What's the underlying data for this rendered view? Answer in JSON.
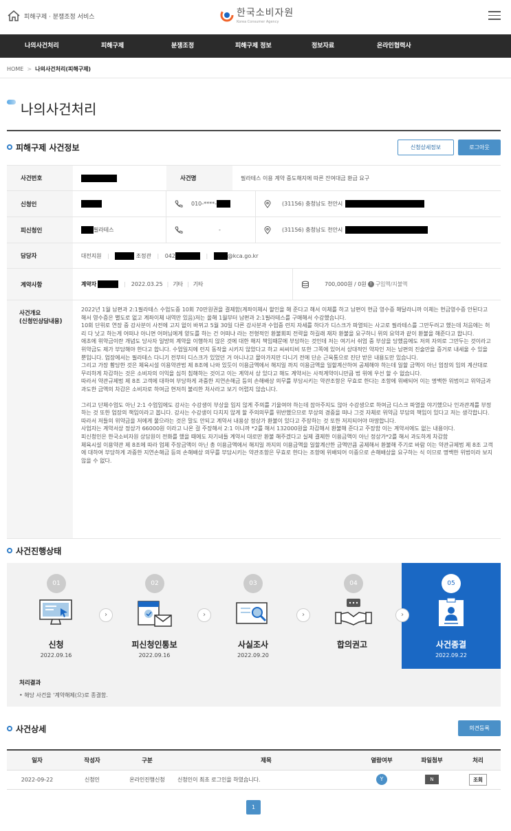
{
  "header": {
    "service_name": "피해구제 · 분쟁조정 서비스",
    "logo_ko": "한국소비자원",
    "logo_en": "Korea Consumer Agency"
  },
  "gnb": [
    "나의사건처리",
    "피해구제",
    "분쟁조정",
    "피해구제 정보",
    "정보자료",
    "온라인협력사"
  ],
  "breadcrumb": {
    "home": "HOME",
    "sep": ">",
    "current": "나의사건처리(피해구제)"
  },
  "page_title": "나의사건처리",
  "section1": {
    "title": "피해구제 사건정보",
    "detail_btn": "신청상세정보",
    "logout_btn": "로그아웃"
  },
  "info": {
    "case_no_label": "사건번호",
    "case_name_label": "사건명",
    "case_name": "필라테스 이용 계약 중도해지에 따른 잔여대금 환급 요구",
    "applicant_label": "신청인",
    "applicant_phone": "010-****-",
    "applicant_addr": "(31156) 충청남도 천안시",
    "respondent_label": "피신청인",
    "respondent_name": "필라테스",
    "respondent_phone": "-",
    "respondent_addr": "(31156) 충청남도 천안시",
    "manager_label": "담당자",
    "manager_branch": "대전지원",
    "manager_title": "조정관",
    "manager_tel": "042",
    "manager_email": "@kca.go.kr",
    "contract_label": "계약사항",
    "contract_party": "계약자",
    "contract_date": "2022.03.25",
    "contract_type1": "기타",
    "contract_type2": "기타",
    "contract_amount": "700,000원 / 0원",
    "contract_amount_note": "구입액/지불액",
    "summary_label_1": "사건개요",
    "summary_label_2": "(신청인상담내용)",
    "summary_p1": "2022년 1월 남편과 2:1필라테스 수업도중 10회 70만원권을 결제함(계좌이체시 할인을 해 준다고 해서 이체를 하고 남편이 현금 영수증 해달라니까 이체는 현금영수증 안된다고 해서 영수증은 별도로 없고 계좌이체 내역만 있음)저는 올해 1월부터 남편과 2:1필라테스를 구매해서 수강했습니다.",
    "summary_p2": "10회 단위로 연장 중 강사분이 사전에 고지 없이 바뀌고 5월 30일 다른 강사분과 수업중 런지 자세를 하다가 디스크가 파열되는 사고로 필라테스를 그만두려고 했는데 처음에는 허리 다 낫고 하는게 어떠냐 아니면 어머님에게 양도를 하는 건 어떠냐 라는 전형적인 환불회피 전략을 하길래 재차 환불을 요구하니 위의 요약과 같이 환불을 해준다고 합니다.",
    "summary_p3": "애초에 위약금이란 개념도 당사자 일방의 계약을 이행하지 않은 것에 대한 해지 책임때문에 부담하는 것인데 저는 여기서 쉬엄 중 부상을 당했음에도 저의 자의로 그만두는 것이라고 위약금도 제가 부담해야 한다고 합니다. 수업일지에 런지 동작을 시키지 않았다고 하고 씨씨티비 또한 그쪽에 있어서 상대적인 약자인 저는 남편의 진술만을 증거로 내세울 수 있을 뿐입니다. 업장에서는 필라테스 다니기 전부터 디스크가 있었던 거 아니냐고 몰아가지만 다니기 전에 단순 근육통으로 진단 받은 내용도만 있습니다.",
    "summary_p4": "그리고 가장 황당한 것은 체육시설 이용약관법 제 8조에 나와 있듯이 이용금액에서 해지일 까지 이용금액을 일할계산하여 공제해야 하는데 일할 금액이 아닌 업장의 임의 계산대로 무리하게 차감하는 것은 소비자의 이익을 심히 침해하는 것이고 이는 계약서 상 있다고 해도 계약서는 사적계약이니만큼 법 위에 우선 할 수 없습니다.",
    "summary_p5": "따라서 약관규제법 제 8조 고객에 대하여 부당하게 과중한 지연손해금 등의 손해배상 의무를 부담시키는 약관조항은 무효로 한다는 조항에 위배되어 이는 명백한 위법이고 위약금과 과도한 금액의 차감은 소비자로 하여금 현저히 불리한 처사라고 보기 어렵지 않습니다.",
    "summary_p6": "그리고 단체수업도 아닌 2:1 수업임에도 강사는 수강생이 부상을 입지 않게 주의를 기울여야 하는데 잡아주지도 않아 수강생으로 하여금 디스크 파열을 야기했으나 인과관계를 부정하는 것 또한 업장의 책임이라고 봅니다. 강사는 수강생이 다치지 않게 할 주의의무를 위반했으므로 부상의 경중을 떠나 그것 자체로 위약금 부담의 책임이 있다고 저는 생각합니다. 따라서 저들의 위약금을 저에게 물으라는 것은 말도 안되고 계약서 내용상 정상가 환불이 있다고 주장하는 것 또한 저지되어야 마땅합니다.",
    "summary_p7": "사업자는 계약서상 정상가 66000원 이라고 나온 걸 주장해서 2:1 이니까 *2를 해서 132000원을 차감해서 환불해 준다고 주장함 이는 계약서에도 없는 내용이다.",
    "summary_p8": "피신청인은 한국소비자원 상담원이 전화를 했을 때에도 자기네들 계약서 대로만 환불 해주겠다고 실제 결제한 이용금액이 아닌 정상가*2를 해서 과도하게 차감함",
    "summary_p9": "체육시설 이용약관 제 8조에 따라 업체 주장금액이 아닌 총 이용금액에서 해지일 까지의 이용금액을 일할계산한 금액만큼 공제해서 환불해 주기로 바람 이는 약관규제법 제 8조 고객에 대하여 부당하게 과중한 지연손해금 등의 손해배상 의무를 부담시키는 약관조항은 무효로 한다는 조항에 위배되어 이중으로 손해배상을 요구하는 식 이므로 명백한 위법이라 보지 않을 수 없다."
  },
  "section2": {
    "title": "사건진행상태"
  },
  "steps": [
    {
      "num": "01",
      "label": "신청",
      "date": "2022.09.16"
    },
    {
      "num": "02",
      "label": "피신청인통보",
      "date": "2022.09.16"
    },
    {
      "num": "03",
      "label": "사실조사",
      "date": "2022.09.20"
    },
    {
      "num": "04",
      "label": "합의권고",
      "date": ""
    },
    {
      "num": "05",
      "label": "사건종결",
      "date": "2022.09.22"
    }
  ],
  "result": {
    "title": "처리결과",
    "text": "• 해당 사건을 '계약해제(으)로 종결함."
  },
  "section3": {
    "title": "사건상세",
    "register_btn": "의견등록"
  },
  "detail": {
    "headers": [
      "일자",
      "작성자",
      "구분",
      "제목",
      "열람여부",
      "파일첨부",
      "처리"
    ],
    "row": {
      "date": "2022-09-22",
      "writer": "신청인",
      "type": "온라인진행신청",
      "subject": "신청인이 최초 로그인을 하였습니다.",
      "read": "Y",
      "file": "N",
      "action": "조회"
    }
  },
  "pager": {
    "current": "1"
  },
  "colors": {
    "primary": "#1a68c4",
    "accent": "#4a90c8",
    "gnb_bg": "#2b2b2b",
    "logo_orange": "#f0642a"
  }
}
